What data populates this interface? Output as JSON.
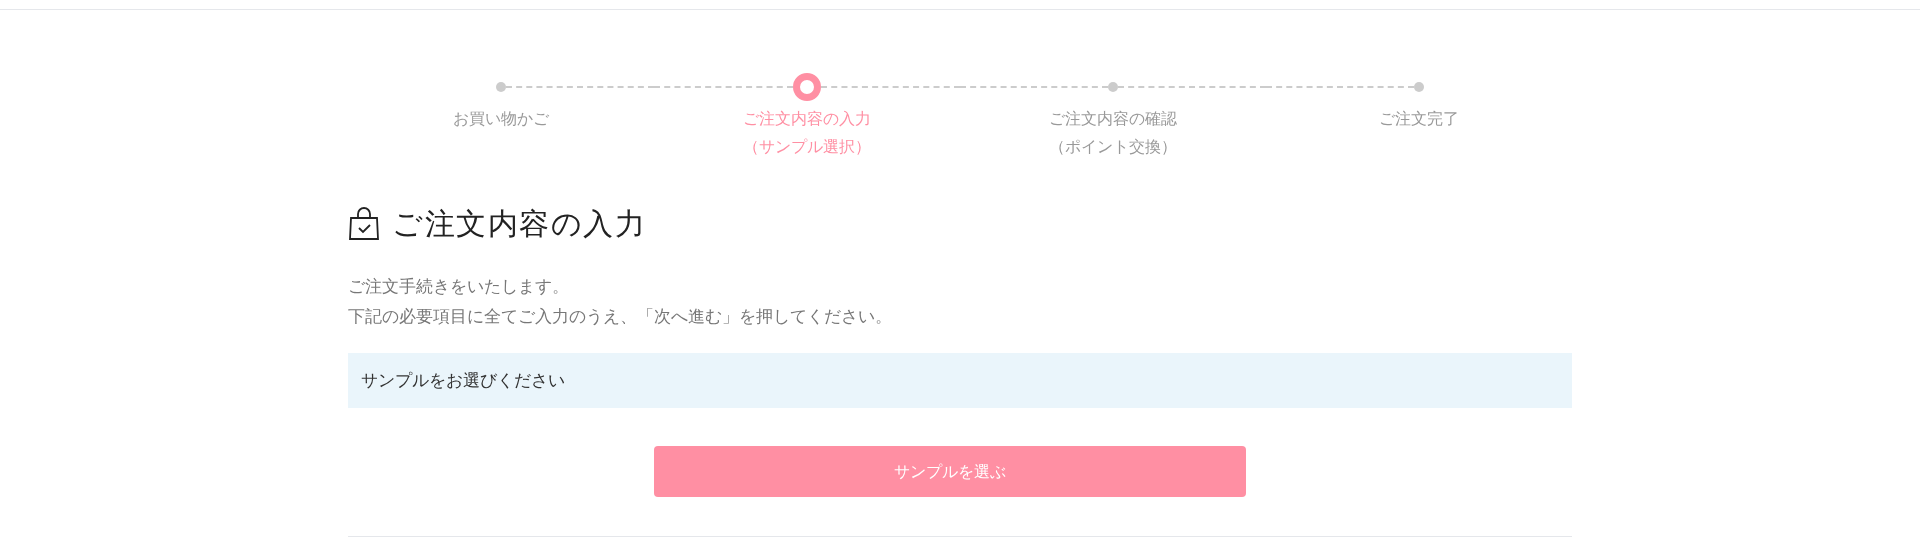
{
  "steps": [
    {
      "lines": [
        "お買い物かご"
      ],
      "selected": false
    },
    {
      "lines": [
        "ご注文内容の入力",
        "（サンプル選択）"
      ],
      "selected": true
    },
    {
      "lines": [
        "ご注文内容の確認",
        "（ポイント交換）"
      ],
      "selected": false
    },
    {
      "lines": [
        "ご注文完了"
      ],
      "selected": false
    }
  ],
  "heading": "ご注文内容の入力",
  "intro": [
    "ご注文手続きをいたします。",
    "下記の必要項目に全てご入力のうえ、「次へ進む」を押してください。"
  ],
  "notice": "サンプルをお選びください",
  "button": "サンプルを選ぶ"
}
